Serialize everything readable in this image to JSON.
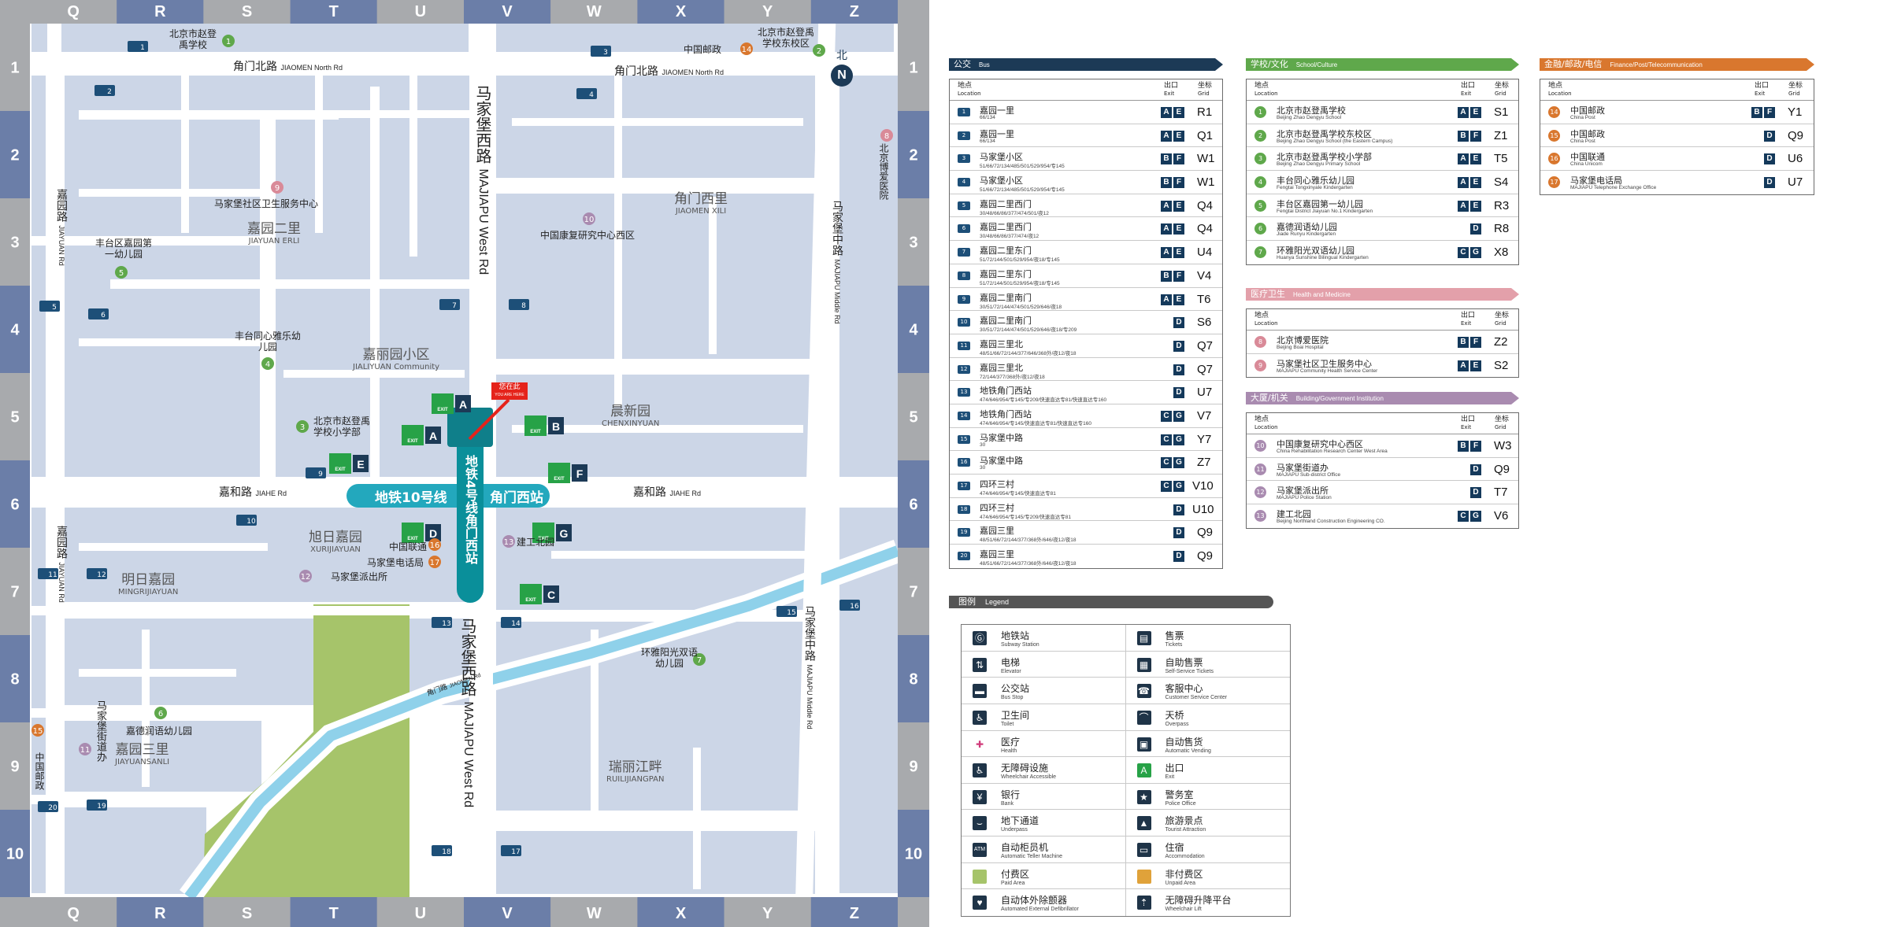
{
  "colors": {
    "frame_blue": "#6b7ea8",
    "frame_grey": "#a8aaad",
    "block": "#ccd6e7",
    "road": "#ffffff",
    "subway": "#0a8f9a",
    "canal": "#8fd1ea",
    "green_area": "#a6c46a",
    "bus_header": "#1c3a56",
    "school_header": "#5fa84b",
    "finance_header": "#d9772e",
    "medical_header": "#e3a0aa",
    "building_header": "#a98bb0",
    "legend_header": "#555555",
    "exit_green": "#27a247"
  },
  "map": {
    "columns": [
      "Q",
      "R",
      "S",
      "T",
      "U",
      "V",
      "W",
      "X",
      "Y",
      "Z"
    ],
    "rows": [
      "1",
      "2",
      "3",
      "4",
      "5",
      "6",
      "7",
      "8",
      "9",
      "10"
    ],
    "north": {
      "zh": "北",
      "en": "N"
    },
    "roads": {
      "jiaomen_north": {
        "zh": "角门北路",
        "en": "JIAOMEN North Rd"
      },
      "jiahe": {
        "zh": "嘉和路",
        "en": "JIAHE Rd"
      },
      "majiapu_west": {
        "zh": "马家堡西路",
        "en": "MAJIAPU West Rd"
      },
      "majiapu_middle": {
        "zh": "马家堡中路",
        "en": "MAJIAPU Middle Rd"
      },
      "jiayuan": {
        "zh": "嘉园路",
        "en": "JIAYUAN Rd"
      },
      "jiaomen": {
        "zh": "角门路",
        "en": "JIAOMEN Rd"
      },
      "majiapu_street": {
        "zh": "马家堡街道办"
      }
    },
    "areas": [
      {
        "zh": "嘉园二里",
        "en": "JIAYUAN ERLI"
      },
      {
        "zh": "角门西里",
        "en": "JIAOMEN XILI"
      },
      {
        "zh": "嘉丽园小区",
        "en": "JIALIYUAN Community"
      },
      {
        "zh": "晨新园",
        "en": "CHENXINYUAN"
      },
      {
        "zh": "旭日嘉园",
        "en": "XURIJIAYUAN"
      },
      {
        "zh": "明日嘉园",
        "en": "MINGRIJIAYUAN"
      },
      {
        "zh": "嘉园三里",
        "en": "JIAYUANSANLI"
      },
      {
        "zh": "瑞丽江畔",
        "en": "RUILIJIANGPAN"
      }
    ],
    "lines": {
      "line10": "地铁10号线",
      "line4": "地铁4号线角门西站",
      "station": "角门西站"
    },
    "you_are_here": {
      "zh": "您在此",
      "en": "YOU ARE HERE"
    },
    "exit_word": "EXIT",
    "pois": {
      "p1": "北京市赵登禹学校",
      "p2": "北京市赵登禹学校东校区",
      "p3": "北京市赵登禹学校小学部",
      "p4": "丰台同心雅乐幼儿园",
      "p5": "丰台区嘉园第一幼儿园",
      "p6": "嘉德润语幼儿园",
      "p7": "环雅阳光双语幼儿园",
      "p8": "北京博爱医院",
      "p9": "马家堡社区卫生服务中心",
      "p10": "中国康复研究中心西区",
      "p11": "马家堡街道办",
      "p12": "马家堡派出所",
      "p13": "建工北园",
      "p14": "中国邮政",
      "p15": "中国邮政",
      "p16": "中国联通",
      "p17": "马家堡电话局"
    }
  },
  "panels": {
    "bus": {
      "title": "公交",
      "title_en": "Bus",
      "col_loc_zh": "地点",
      "col_loc_en": "Location",
      "col_exit_zh": "出口",
      "col_exit_en": "Exit",
      "col_grid_zh": "坐标",
      "col_grid_en": "Grid",
      "rows": [
        {
          "n": "1",
          "name": "嘉园一里",
          "routes": "66/134",
          "exits": [
            "A",
            "E"
          ],
          "grid": "R1"
        },
        {
          "n": "2",
          "name": "嘉园一里",
          "routes": "66/134",
          "exits": [
            "A",
            "E"
          ],
          "grid": "Q1"
        },
        {
          "n": "3",
          "name": "马家堡小区",
          "routes": "51/66/72/134/485/501/529/954/专145",
          "exits": [
            "B",
            "F"
          ],
          "grid": "W1"
        },
        {
          "n": "4",
          "name": "马家堡小区",
          "routes": "51/66/72/134/485/501/529/954/专145",
          "exits": [
            "B",
            "F"
          ],
          "grid": "W1"
        },
        {
          "n": "5",
          "name": "嘉园二里西门",
          "routes": "30/48/66/86/377/474/501/夜12",
          "exits": [
            "A",
            "E"
          ],
          "grid": "Q4"
        },
        {
          "n": "6",
          "name": "嘉园二里西门",
          "routes": "30/48/66/86/377/474/夜12",
          "exits": [
            "A",
            "E"
          ],
          "grid": "Q4"
        },
        {
          "n": "7",
          "name": "嘉园二里东门",
          "routes": "51/72/144/501/529/954/夜18/专145",
          "exits": [
            "A",
            "E"
          ],
          "grid": "U4"
        },
        {
          "n": "8",
          "name": "嘉园二里东门",
          "routes": "51/72/144/501/529/954/夜18/专145",
          "exits": [
            "B",
            "F"
          ],
          "grid": "V4"
        },
        {
          "n": "9",
          "name": "嘉园二里南门",
          "routes": "30/51/72/144/474/501/529/646/夜18",
          "exits": [
            "A",
            "E"
          ],
          "grid": "T6"
        },
        {
          "n": "10",
          "name": "嘉园二里南门",
          "routes": "30/51/72/144/474/501/529/646/夜18/专209",
          "exits": [
            "D"
          ],
          "grid": "S6"
        },
        {
          "n": "11",
          "name": "嘉园三里北",
          "routes": "48/51/66/72/144/377/646/368外/夜12/夜18",
          "exits": [
            "D"
          ],
          "grid": "Q7"
        },
        {
          "n": "12",
          "name": "嘉园三里北",
          "routes": "72/144/377/368外/夜12/夜18",
          "exits": [
            "D"
          ],
          "grid": "Q7"
        },
        {
          "n": "13",
          "name": "地铁角门西站",
          "routes": "474/646/954/专145/专209/快速直达专81/快速直达专160",
          "exits": [
            "D"
          ],
          "grid": "U7"
        },
        {
          "n": "14",
          "name": "地铁角门西站",
          "routes": "474/646/954/专145/快速直达专81/快速直达专160",
          "exits": [
            "C",
            "G"
          ],
          "grid": "V7"
        },
        {
          "n": "15",
          "name": "马家堡中路",
          "routes": "30",
          "exits": [
            "C",
            "G"
          ],
          "grid": "Y7"
        },
        {
          "n": "16",
          "name": "马家堡中路",
          "routes": "30",
          "exits": [
            "C",
            "G"
          ],
          "grid": "Z7"
        },
        {
          "n": "17",
          "name": "四环三村",
          "routes": "474/646/954/专145/快速直达专81",
          "exits": [
            "C",
            "G"
          ],
          "grid": "V10"
        },
        {
          "n": "18",
          "name": "四环三村",
          "routes": "474/646/954/专145/专209/快速直达专81",
          "exits": [
            "D"
          ],
          "grid": "U10"
        },
        {
          "n": "19",
          "name": "嘉园三里",
          "routes": "48/51/66/72/144/377/368外/646/夜12/夜18",
          "exits": [
            "D"
          ],
          "grid": "Q9"
        },
        {
          "n": "20",
          "name": "嘉园三里",
          "routes": "48/51/66/72/144/377/368外/646/夜12/夜18",
          "exits": [
            "D"
          ],
          "grid": "Q9"
        }
      ]
    },
    "school": {
      "title": "学校/文化",
      "title_en": "School/Culture",
      "rows": [
        {
          "n": "1",
          "name": "北京市赵登禹学校",
          "en": "Beijing Zhao Dengyu School",
          "exits": [
            "A",
            "E"
          ],
          "grid": "S1"
        },
        {
          "n": "2",
          "name": "北京市赵登禹学校东校区",
          "en": "Beijing Zhao Dengyu School (the Eastern Campus)",
          "exits": [
            "B",
            "F"
          ],
          "grid": "Z1"
        },
        {
          "n": "3",
          "name": "北京市赵登禹学校小学部",
          "en": "Beijing Zhao Dengyu Primary School",
          "exits": [
            "A",
            "E"
          ],
          "grid": "T5"
        },
        {
          "n": "4",
          "name": "丰台同心雅乐幼儿园",
          "en": "Fengtai Tongxinyale Kindergarten",
          "exits": [
            "A",
            "E"
          ],
          "grid": "S4"
        },
        {
          "n": "5",
          "name": "丰台区嘉园第一幼儿园",
          "en": "Fengtai District Jiayuan No.1 Kindergarten",
          "exits": [
            "A",
            "E"
          ],
          "grid": "R3"
        },
        {
          "n": "6",
          "name": "嘉德润语幼儿园",
          "en": "Jiade Runyu Kindergarten",
          "exits": [
            "D"
          ],
          "grid": "R8"
        },
        {
          "n": "7",
          "name": "环雅阳光双语幼儿园",
          "en": "Huanya Sunshine Bilingual Kindergarten",
          "exits": [
            "C",
            "G"
          ],
          "grid": "X8"
        }
      ]
    },
    "medical": {
      "title": "医疗卫生",
      "title_en": "Health and Medicine",
      "rows": [
        {
          "n": "8",
          "name": "北京博爱医院",
          "en": "Beijing Boai Hospital",
          "exits": [
            "B",
            "F"
          ],
          "grid": "Z2"
        },
        {
          "n": "9",
          "name": "马家堡社区卫生服务中心",
          "en": "MAJIAPU Community Health Service Center",
          "exits": [
            "A",
            "E"
          ],
          "grid": "S2"
        }
      ]
    },
    "building": {
      "title": "大厦/机关",
      "title_en": "Building/Government Institution",
      "rows": [
        {
          "n": "10",
          "name": "中国康复研究中心西区",
          "en": "China Rehabilitation Research Center West Area",
          "exits": [
            "B",
            "F"
          ],
          "grid": "W3"
        },
        {
          "n": "11",
          "name": "马家堡街道办",
          "en": "MAJIAPU Sub-district Office",
          "exits": [
            "D"
          ],
          "grid": "Q9"
        },
        {
          "n": "12",
          "name": "马家堡派出所",
          "en": "MAJIAPU Police Station",
          "exits": [
            "D"
          ],
          "grid": "T7"
        },
        {
          "n": "13",
          "name": "建工北园",
          "en": "Beijing Northland Construction Engineering CO.",
          "exits": [
            "C",
            "G"
          ],
          "grid": "V6"
        }
      ]
    },
    "finance": {
      "title": "金融/邮政/电信",
      "title_en": "Finance/Post/Telecommunication",
      "rows": [
        {
          "n": "14",
          "name": "中国邮政",
          "en": "China Post",
          "exits": [
            "B",
            "F"
          ],
          "grid": "Y1"
        },
        {
          "n": "15",
          "name": "中国邮政",
          "en": "China Post",
          "exits": [
            "D"
          ],
          "grid": "Q9"
        },
        {
          "n": "16",
          "name": "中国联通",
          "en": "China Unicom",
          "exits": [
            "D"
          ],
          "grid": "U6"
        },
        {
          "n": "17",
          "name": "马家堡电话局",
          "en": "MAJIAPU Telephone Exchange Office",
          "exits": [
            "D"
          ],
          "grid": "U7"
        }
      ]
    }
  },
  "legend": {
    "title": "图例",
    "title_en": "Legend",
    "items": [
      {
        "icon": "subway-icon",
        "glyph": "Ⓖ",
        "zh": "地铁站",
        "en": "Subway Station"
      },
      {
        "icon": "ticket-icon",
        "glyph": "▤",
        "zh": "售票",
        "en": "Tickets"
      },
      {
        "icon": "elevator-icon",
        "glyph": "⇅",
        "zh": "电梯",
        "en": "Elevator"
      },
      {
        "icon": "self-ticket-icon",
        "glyph": "▦",
        "zh": "自助售票",
        "en": "Self-Service Tickets"
      },
      {
        "icon": "bus-icon",
        "glyph": "▬",
        "zh": "公交站",
        "en": "Bus Stop"
      },
      {
        "icon": "customer-service-icon",
        "glyph": "☎",
        "zh": "客服中心",
        "en": "Customer Service Center"
      },
      {
        "icon": "toilet-icon",
        "glyph": "♿",
        "zh": "卫生间",
        "en": "Toilet"
      },
      {
        "icon": "overpass-icon",
        "glyph": "⌒",
        "zh": "天桥",
        "en": "Overpass"
      },
      {
        "icon": "health-icon",
        "glyph": "✚",
        "zh": "医疗",
        "en": "Health"
      },
      {
        "icon": "vending-icon",
        "glyph": "▣",
        "zh": "自动售货",
        "en": "Automatic Vending"
      },
      {
        "icon": "wheelchair-icon",
        "glyph": "♿",
        "zh": "无障碍设施",
        "en": "Wheelchair Accessible"
      },
      {
        "icon": "exit-icon",
        "glyph": "A",
        "zh": "出口",
        "en": "Exit"
      },
      {
        "icon": "bank-icon",
        "glyph": "¥",
        "zh": "银行",
        "en": "Bank"
      },
      {
        "icon": "police-icon",
        "glyph": "★",
        "zh": "警务室",
        "en": "Police Office"
      },
      {
        "icon": "underpass-icon",
        "glyph": "⌣",
        "zh": "地下通道",
        "en": "Underpass"
      },
      {
        "icon": "tourist-icon",
        "glyph": "▲",
        "zh": "旅游景点",
        "en": "Tourist Attraction"
      },
      {
        "icon": "atm-icon",
        "glyph": "ATM",
        "zh": "自动柜员机",
        "en": "Automatic Teller Machine"
      },
      {
        "icon": "accommodation-icon",
        "glyph": "▭",
        "zh": "住宿",
        "en": "Accommodation"
      },
      {
        "icon": "paid-area-icon",
        "glyph": "",
        "zh": "付费区",
        "en": "Paid Area"
      },
      {
        "icon": "unpaid-area-icon",
        "glyph": "",
        "zh": "非付费区",
        "en": "Unpaid Area"
      },
      {
        "icon": "aed-icon",
        "glyph": "♥",
        "zh": "自动体外除颤器",
        "en": "Automated External Defibrillator"
      },
      {
        "icon": "wheelchair-lift-icon",
        "glyph": "⇡",
        "zh": "无障碍升降平台",
        "en": "Wheelchair Lift"
      }
    ]
  }
}
